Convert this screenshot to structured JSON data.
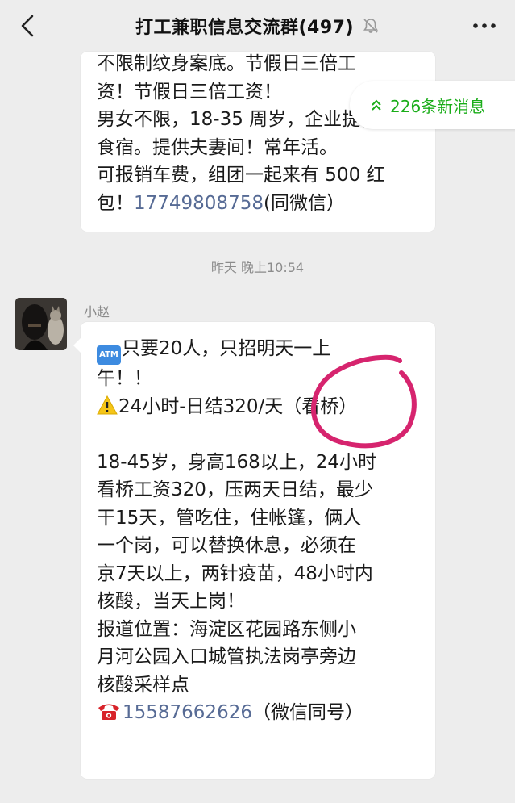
{
  "header": {
    "title": "打工兼职信息交流群(497)",
    "icons": {
      "back": "chevron-left-icon",
      "mute": "bell-muted-icon",
      "more": "more-dots-icon"
    }
  },
  "new_messages": {
    "label": "226条新消息",
    "icon": "double-chevron-up-icon",
    "color": "#1aad19"
  },
  "message1": {
    "lines": [
      "不限制纹身案底。节假日三倍工",
      "资！节假日三倍工资！",
      "男女不限，18-35 周岁，企业提供",
      "食宿。提供夫妻间！常年活。",
      "可报销车费，组团一起来有 500 红"
    ],
    "last_line_prefix": "包！",
    "phone": "17749808758",
    "last_line_suffix": "(同微信）"
  },
  "timestamp": "昨天 晚上10:54",
  "message2": {
    "sender": "小赵",
    "line1_icon": "ATM",
    "line1": "只要20人，只招明天一上",
    "line2": "午！！",
    "line3": "24小时-日结320/天（看桥）",
    "body_lines": [
      "18-45岁，身高168以上，24小时",
      "看桥工资320，压两天日结，最少",
      "干15天，管吃住，住帐篷，俩人",
      "一个岗，可以替换休息，必须在",
      "京7天以上，两针疫苗，48小时内",
      "核酸，当天上岗！",
      "报道位置：海淀区花园路东侧小",
      "月河公园入口城管执法岗亭旁边",
      "核酸采样点"
    ],
    "phone": "15587662626",
    "phone_suffix": "（微信同号）"
  },
  "colors": {
    "link": "#576b95",
    "annotation": "#d6246e",
    "background": "#ededed"
  }
}
